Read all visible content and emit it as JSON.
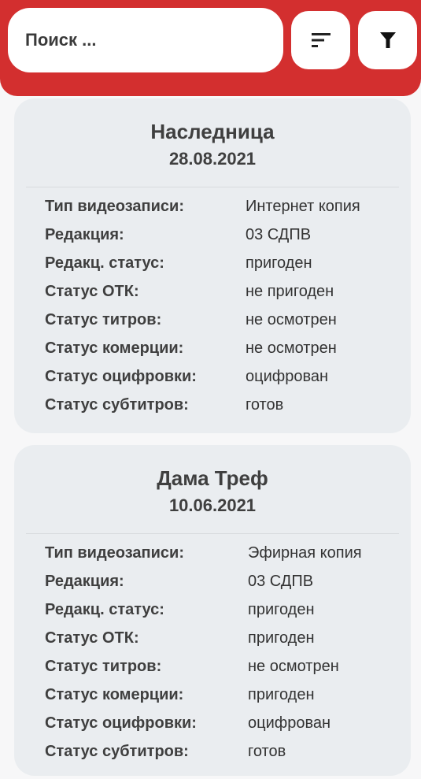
{
  "header": {
    "search_placeholder": "Поиск ...",
    "accent": "#d32f2f"
  },
  "cards": [
    {
      "title": "Наследница",
      "date": "28.08.2021",
      "fields": [
        {
          "label": "Тип видеозаписи:",
          "value": "Интернет копия"
        },
        {
          "label": "Редакция:",
          "value": "03 СДПВ"
        },
        {
          "label": "Редакц. статус:",
          "value": "пригоден"
        },
        {
          "label": "Статус ОТК:",
          "value": "не пригоден"
        },
        {
          "label": "Статус титров:",
          "value": "не осмотрен"
        },
        {
          "label": "Статус комерции:",
          "value": "не осмотрен"
        },
        {
          "label": "Статус оцифровки:",
          "value": "оцифрован"
        },
        {
          "label": "Статус субтитров:",
          "value": "готов"
        }
      ]
    },
    {
      "title": "Дама Треф",
      "date": "10.06.2021",
      "fields": [
        {
          "label": "Тип видеозаписи:",
          "value": "Эфирная копия"
        },
        {
          "label": "Редакция:",
          "value": "03 СДПВ"
        },
        {
          "label": "Редакц. статус:",
          "value": "пригоден"
        },
        {
          "label": "Статус ОТК:",
          "value": "пригоден"
        },
        {
          "label": "Статус титров:",
          "value": "не осмотрен"
        },
        {
          "label": "Статус комерции:",
          "value": "пригоден"
        },
        {
          "label": "Статус оцифровки:",
          "value": "оцифрован"
        },
        {
          "label": "Статус субтитров:",
          "value": "готов"
        }
      ]
    }
  ]
}
